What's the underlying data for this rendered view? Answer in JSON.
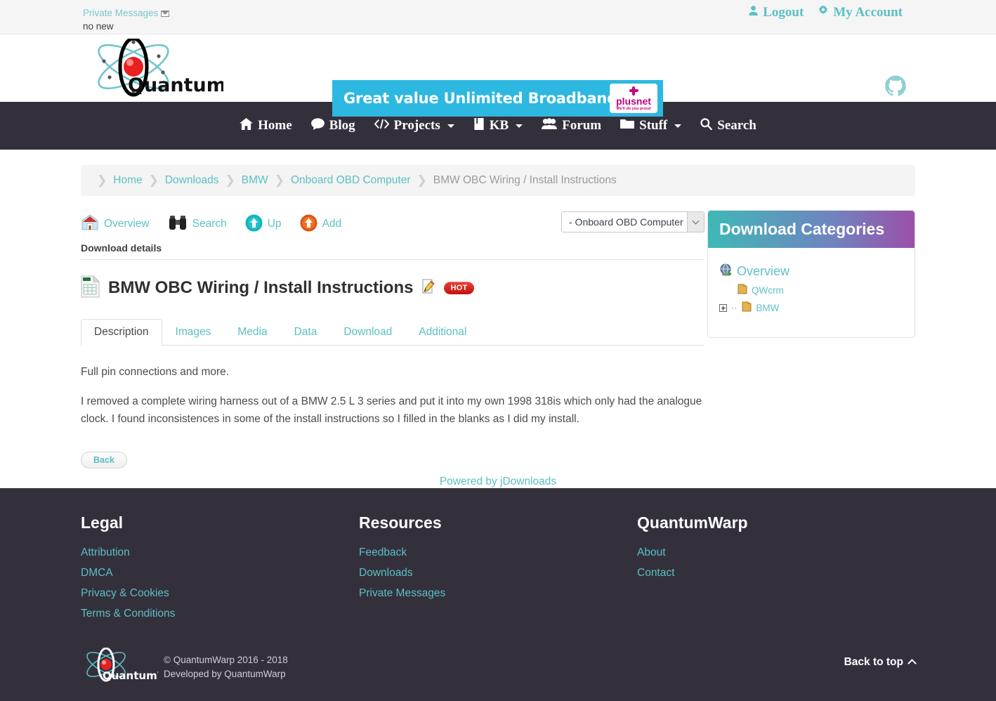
{
  "topbar": {
    "private_messages_label": "Private Messages",
    "private_messages_status": "no new",
    "logout_label": "Logout",
    "account_label": "My Account"
  },
  "header": {
    "logo_text": "QuantumWarp",
    "banner_text": "Great value Unlimited Broadband",
    "banner_brand": "plusnet",
    "banner_tagline": "We'll do you proud",
    "github_icon": "github-icon"
  },
  "nav": {
    "items": [
      {
        "label": "Home",
        "icon": "home-icon",
        "caret": false
      },
      {
        "label": "Blog",
        "icon": "comment-icon",
        "caret": false
      },
      {
        "label": "Projects",
        "icon": "code-icon",
        "caret": true
      },
      {
        "label": "KB",
        "icon": "book-icon",
        "caret": true
      },
      {
        "label": "Forum",
        "icon": "users-icon",
        "caret": false
      },
      {
        "label": "Stuff",
        "icon": "folder-icon",
        "caret": true
      },
      {
        "label": "Search",
        "icon": "search-icon",
        "caret": false
      }
    ]
  },
  "breadcrumb": {
    "items": [
      "Home",
      "Downloads",
      "BMW",
      "Onboard OBD Computer"
    ],
    "current": "BMW OBC Wiring / Install Instructions"
  },
  "toolbar": {
    "overview_label": "Overview",
    "search_label": "Search",
    "up_label": "Up",
    "add_label": "Add",
    "category_select_value": "- Onboard OBD Computer"
  },
  "content": {
    "section_label": "Download details",
    "title": "BMW OBC Wiring / Install Instructions",
    "badge": "HOT",
    "file_icon": "excel-file-icon",
    "edit_icon": "edit-pencil-icon",
    "tabs": [
      {
        "label": "Description",
        "active": true
      },
      {
        "label": "Images",
        "active": false
      },
      {
        "label": "Media",
        "active": false
      },
      {
        "label": "Data",
        "active": false
      },
      {
        "label": "Download",
        "active": false
      },
      {
        "label": "Additional",
        "active": false
      }
    ],
    "paragraph_1": "Full pin connections and more.",
    "paragraph_2": "I removed a complete wiring harness out of a BMW 2.5 L 3 series and put it into my own 1998 318is which only had the analogue clock. I found inconsistences in some of the install instructions so I filled in the blanks as I did my install.",
    "back_label": "Back",
    "powered_by": "Powered by jDownloads"
  },
  "sidebar": {
    "title": "Download Categories",
    "tree": [
      {
        "label": "Overview",
        "icon": "globe-icon",
        "level": 0,
        "expandable": false
      },
      {
        "label": "QWcrm",
        "icon": "folder-icon",
        "level": 1,
        "expandable": false
      },
      {
        "label": "BMW",
        "icon": "folder-icon",
        "level": 0,
        "expandable": true
      }
    ]
  },
  "footer": {
    "columns": [
      {
        "heading": "Legal",
        "links": [
          "Attribution",
          "DMCA",
          "Privacy & Cookies",
          "Terms & Conditions"
        ]
      },
      {
        "heading": "Resources",
        "links": [
          "Feedback",
          "Downloads",
          "Private Messages"
        ]
      },
      {
        "heading": "QuantumWarp",
        "links": [
          "About",
          "Contact"
        ]
      }
    ],
    "copyright": "© QuantumWarp 2016 - 2018",
    "developed": "Developed by QuantumWarp",
    "back_to_top": "Back to top",
    "logo_text": "QuantumWarp"
  },
  "colors": {
    "teal": "#5bbfc4",
    "dark": "#33303c",
    "banner_blue": "#2cb8e0",
    "plusnet_magenta": "#c6007e",
    "hot_red": "#c4110d",
    "module_gradient_start": "#3fb8b6",
    "module_gradient_end": "#9b4fa8"
  }
}
